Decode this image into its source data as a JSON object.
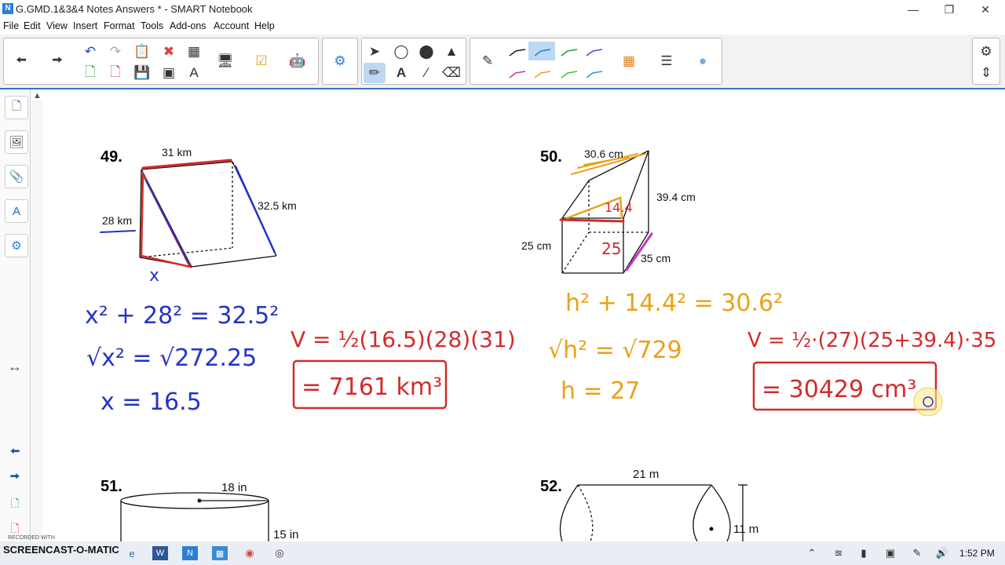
{
  "window": {
    "title": "G.GMD.1&3&4 Notes Answers * - SMART Notebook"
  },
  "menu": [
    "File",
    "Edit",
    "View",
    "Insert",
    "Format",
    "Tools",
    "Add-ons",
    "Account",
    "Help"
  ],
  "problems": {
    "p49": {
      "number": "49.",
      "top": "31 km",
      "side": "32.5 km",
      "left": "28 km",
      "x_label": "x"
    },
    "p50": {
      "number": "50.",
      "top": "30.6 cm",
      "height": "39.4 cm",
      "depth": "25 cm",
      "width": "35 cm",
      "inner_h": "14.4",
      "inner_25": "25"
    },
    "p51": {
      "number": "51.",
      "diameter": "18 in",
      "height": "15 in"
    },
    "p52": {
      "number": "52.",
      "length": "21 m",
      "diameter": "11 m"
    }
  },
  "ink": {
    "eq49_1": "x² + 28² = 32.5²",
    "eq49_2": "√x² = √272.25",
    "eq49_3": "x = 16.5",
    "vol49": "V = ½(16.5)(28)(31)",
    "ans49": "= 7161 km³",
    "eq50_1": "h² + 14.4² = 30.6²",
    "eq50_2": "√h² = √729",
    "eq50_3": "h = 27",
    "vol50": "V = ½·(27)(25+39.4)·35",
    "ans50": "= 30429 cm³"
  },
  "taskbar": {
    "recorder": "SCREENCAST-O-MATIC",
    "watermark": "RECORDED WITH",
    "time": "1:52 PM"
  },
  "colors": {
    "red": "#d42a2a",
    "blue": "#2235c8",
    "orange": "#e8a21a",
    "purple": "#c038c8",
    "accent": "#3a6fc4"
  }
}
